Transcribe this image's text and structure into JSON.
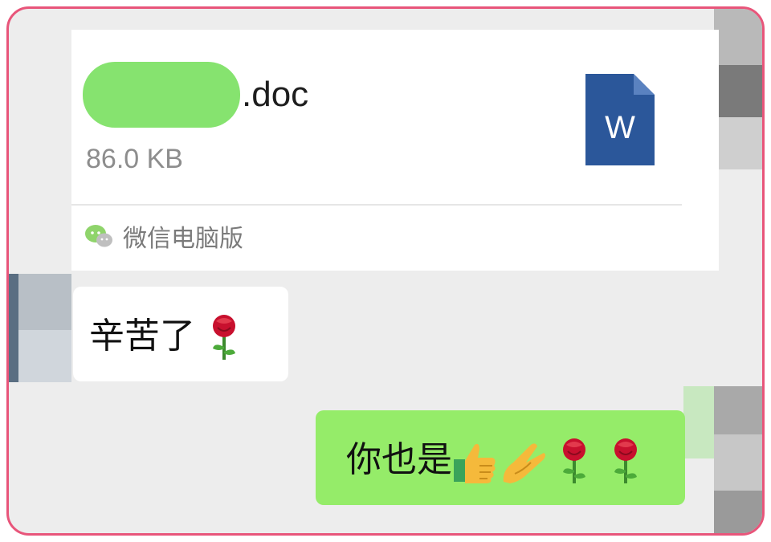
{
  "file_message": {
    "file_name_suffix": ".doc",
    "file_size": "86.0 KB",
    "file_icon_letter": "W",
    "source_label": "微信电脑版"
  },
  "messages": [
    {
      "direction": "received",
      "text": "辛苦了",
      "emojis": [
        "rose-icon"
      ]
    },
    {
      "direction": "sent",
      "text": "你也是",
      "emojis": [
        "thumbs-up-icon",
        "ok-hand-icon",
        "rose-icon",
        "rose-icon"
      ]
    }
  ],
  "colors": {
    "sent_bubble": "#95ec69",
    "received_bubble": "#ffffff",
    "redaction": "#86e36f",
    "word_blue": "#2b579a",
    "frame_border": "#e8557a",
    "chat_background": "#ededed"
  }
}
